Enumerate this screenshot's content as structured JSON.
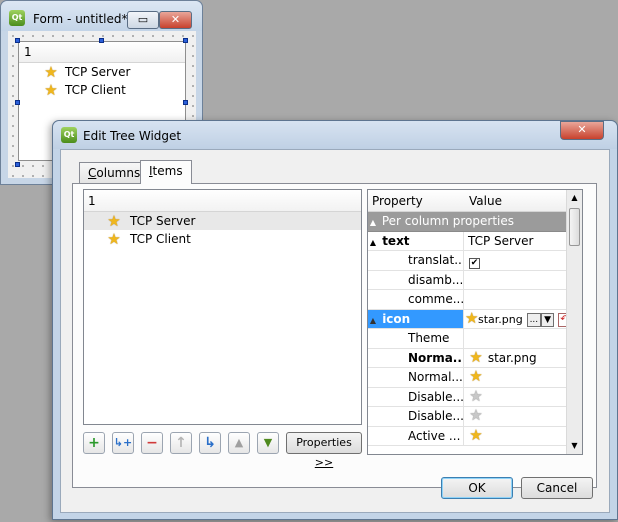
{
  "form_window": {
    "title": "Form - untitled*",
    "app_icon": "Qt",
    "minimize_glyph": "▭",
    "close_glyph": "✕",
    "tree": {
      "header": "1",
      "items": [
        "TCP Server",
        "TCP Client"
      ]
    }
  },
  "dialog": {
    "title": "Edit Tree Widget",
    "app_icon": "Qt",
    "close_glyph": "✕",
    "tabs": [
      {
        "label": "Columns",
        "mnemonic": "C",
        "rest": "olumns",
        "active": false
      },
      {
        "label": "Items",
        "mnemonic": "I",
        "rest": "tems",
        "active": true
      }
    ],
    "tree": {
      "header": "1",
      "items": [
        {
          "label": "TCP Server",
          "selected": true
        },
        {
          "label": "TCP Client",
          "selected": false
        }
      ]
    },
    "toolbar": {
      "new_item": "+",
      "new_subitem": "↳+",
      "delete_item": "−",
      "move_left": "↑",
      "move_right": "↳",
      "move_up": "▲",
      "move_down": "▼",
      "properties_label": "Properties",
      "properties_mnemonic": ">>"
    },
    "property_editor": {
      "columns": [
        "Property",
        "Value"
      ],
      "rows": [
        {
          "name": "Per column properties",
          "value": "",
          "type": "group",
          "expander": "▲"
        },
        {
          "name": "text",
          "value": "TCP Server",
          "bold": true,
          "expander": "▲"
        },
        {
          "name": "translat...",
          "value": "",
          "checkbox": true,
          "checked": true
        },
        {
          "name": "disamb...",
          "value": ""
        },
        {
          "name": "comme...",
          "value": ""
        },
        {
          "name": "icon",
          "value": "star.png",
          "selected": true,
          "expander": "▲",
          "icon": "star",
          "buttons": [
            "...",
            "▼"
          ],
          "reset": "↶"
        },
        {
          "name": "Theme",
          "value": ""
        },
        {
          "name": "Norma...",
          "value": "star.png",
          "bold": true,
          "icon": "star"
        },
        {
          "name": "Normal...",
          "value": "",
          "icon": "star"
        },
        {
          "name": "Disable...",
          "value": "",
          "icon": "star-grey"
        },
        {
          "name": "Disable...",
          "value": "",
          "icon": "star-grey"
        },
        {
          "name": "Active ...",
          "value": "",
          "icon": "star"
        }
      ],
      "scroll_up": "▲",
      "scroll_down": "▼"
    },
    "ok_label": "OK",
    "cancel_label": "Cancel"
  },
  "colors": {
    "desktop": "#a9a9a9",
    "window_frame": "#c3d4e7",
    "selection": "#3399ff",
    "group_row": "#9b9b9b"
  }
}
